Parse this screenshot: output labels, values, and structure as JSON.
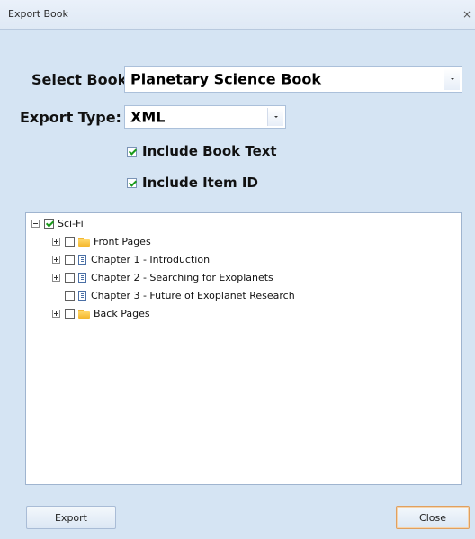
{
  "window": {
    "title": "Export Book",
    "close_glyph": "×"
  },
  "form": {
    "select_book_label": "Select Book:",
    "select_book_value": "Planetary Science Book",
    "export_type_label": "Export Type:",
    "export_type_value": "XML",
    "include_book_text": {
      "label": "Include Book Text",
      "checked": true
    },
    "include_item_id": {
      "label": "Include Item ID",
      "checked": true
    }
  },
  "tree": {
    "root": {
      "label": "Sci-Fi",
      "checked": true,
      "expanded": true
    },
    "items": [
      {
        "label": "Front Pages",
        "icon": "folder-icon",
        "expandable": true,
        "checked": false
      },
      {
        "label": "Chapter 1 - Introduction",
        "icon": "document-icon",
        "expandable": true,
        "checked": false
      },
      {
        "label": "Chapter 2 - Searching for Exoplanets",
        "icon": "document-icon",
        "expandable": true,
        "checked": false
      },
      {
        "label": "Chapter 3 - Future of Exoplanet Research",
        "icon": "document-icon",
        "expandable": false,
        "checked": false
      },
      {
        "label": "Back Pages",
        "icon": "folder-icon",
        "expandable": true,
        "checked": false
      }
    ]
  },
  "buttons": {
    "export": "Export",
    "close": "Close"
  },
  "colors": {
    "dialog_background": "#d5e4f3",
    "check_green": "#1a9a1a",
    "folder_yellow": "#f4b62b",
    "focus_orange": "#e0a060"
  }
}
